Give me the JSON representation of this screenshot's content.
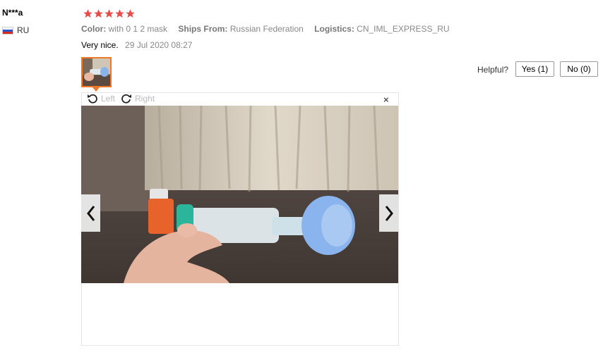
{
  "reviewer": {
    "name": "N***a",
    "country": "RU",
    "flag": "russia-flag"
  },
  "rating": {
    "stars": 5,
    "max": 5,
    "color": "#e94a4a"
  },
  "attributes": {
    "color_label": "Color:",
    "color_value": "with 0 1 2 mask",
    "ships_label": "Ships From:",
    "ships_value": "Russian Federation",
    "logistics_label": "Logistics:",
    "logistics_value": "CN_IML_EXPRESS_RU"
  },
  "review": {
    "text": "Very nice.",
    "date": "29 Jul 2020 08:27"
  },
  "helpful": {
    "label": "Helpful?",
    "yes": "Yes (1)",
    "no": "No (0)"
  },
  "viewer": {
    "rotate_left": "Left",
    "rotate_right": "Right",
    "close": "×",
    "accent": "#ee7a29"
  }
}
